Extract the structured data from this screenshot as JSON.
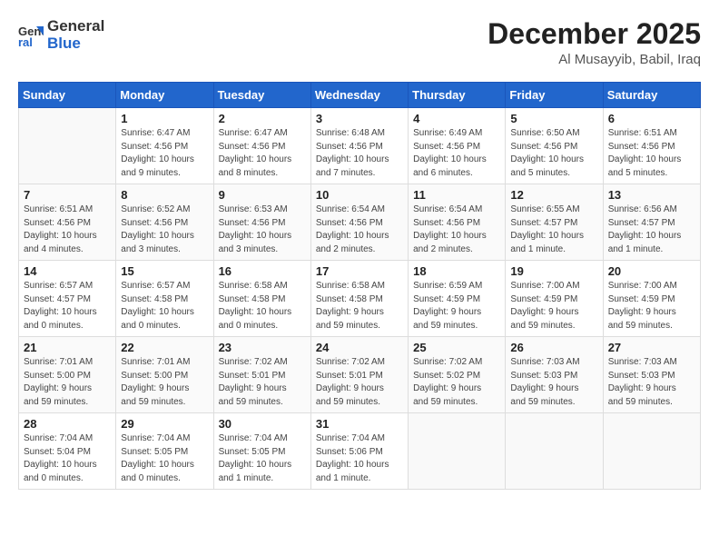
{
  "header": {
    "logo_line1": "General",
    "logo_line2": "Blue",
    "month": "December 2025",
    "location": "Al Musayyib, Babil, Iraq"
  },
  "days_of_week": [
    "Sunday",
    "Monday",
    "Tuesday",
    "Wednesday",
    "Thursday",
    "Friday",
    "Saturday"
  ],
  "weeks": [
    [
      {
        "num": "",
        "info": ""
      },
      {
        "num": "1",
        "info": "Sunrise: 6:47 AM\nSunset: 4:56 PM\nDaylight: 10 hours\nand 9 minutes."
      },
      {
        "num": "2",
        "info": "Sunrise: 6:47 AM\nSunset: 4:56 PM\nDaylight: 10 hours\nand 8 minutes."
      },
      {
        "num": "3",
        "info": "Sunrise: 6:48 AM\nSunset: 4:56 PM\nDaylight: 10 hours\nand 7 minutes."
      },
      {
        "num": "4",
        "info": "Sunrise: 6:49 AM\nSunset: 4:56 PM\nDaylight: 10 hours\nand 6 minutes."
      },
      {
        "num": "5",
        "info": "Sunrise: 6:50 AM\nSunset: 4:56 PM\nDaylight: 10 hours\nand 5 minutes."
      },
      {
        "num": "6",
        "info": "Sunrise: 6:51 AM\nSunset: 4:56 PM\nDaylight: 10 hours\nand 5 minutes."
      }
    ],
    [
      {
        "num": "7",
        "info": "Sunrise: 6:51 AM\nSunset: 4:56 PM\nDaylight: 10 hours\nand 4 minutes."
      },
      {
        "num": "8",
        "info": "Sunrise: 6:52 AM\nSunset: 4:56 PM\nDaylight: 10 hours\nand 3 minutes."
      },
      {
        "num": "9",
        "info": "Sunrise: 6:53 AM\nSunset: 4:56 PM\nDaylight: 10 hours\nand 3 minutes."
      },
      {
        "num": "10",
        "info": "Sunrise: 6:54 AM\nSunset: 4:56 PM\nDaylight: 10 hours\nand 2 minutes."
      },
      {
        "num": "11",
        "info": "Sunrise: 6:54 AM\nSunset: 4:56 PM\nDaylight: 10 hours\nand 2 minutes."
      },
      {
        "num": "12",
        "info": "Sunrise: 6:55 AM\nSunset: 4:57 PM\nDaylight: 10 hours\nand 1 minute."
      },
      {
        "num": "13",
        "info": "Sunrise: 6:56 AM\nSunset: 4:57 PM\nDaylight: 10 hours\nand 1 minute."
      }
    ],
    [
      {
        "num": "14",
        "info": "Sunrise: 6:57 AM\nSunset: 4:57 PM\nDaylight: 10 hours\nand 0 minutes."
      },
      {
        "num": "15",
        "info": "Sunrise: 6:57 AM\nSunset: 4:58 PM\nDaylight: 10 hours\nand 0 minutes."
      },
      {
        "num": "16",
        "info": "Sunrise: 6:58 AM\nSunset: 4:58 PM\nDaylight: 10 hours\nand 0 minutes."
      },
      {
        "num": "17",
        "info": "Sunrise: 6:58 AM\nSunset: 4:58 PM\nDaylight: 9 hours\nand 59 minutes."
      },
      {
        "num": "18",
        "info": "Sunrise: 6:59 AM\nSunset: 4:59 PM\nDaylight: 9 hours\nand 59 minutes."
      },
      {
        "num": "19",
        "info": "Sunrise: 7:00 AM\nSunset: 4:59 PM\nDaylight: 9 hours\nand 59 minutes."
      },
      {
        "num": "20",
        "info": "Sunrise: 7:00 AM\nSunset: 4:59 PM\nDaylight: 9 hours\nand 59 minutes."
      }
    ],
    [
      {
        "num": "21",
        "info": "Sunrise: 7:01 AM\nSunset: 5:00 PM\nDaylight: 9 hours\nand 59 minutes."
      },
      {
        "num": "22",
        "info": "Sunrise: 7:01 AM\nSunset: 5:00 PM\nDaylight: 9 hours\nand 59 minutes."
      },
      {
        "num": "23",
        "info": "Sunrise: 7:02 AM\nSunset: 5:01 PM\nDaylight: 9 hours\nand 59 minutes."
      },
      {
        "num": "24",
        "info": "Sunrise: 7:02 AM\nSunset: 5:01 PM\nDaylight: 9 hours\nand 59 minutes."
      },
      {
        "num": "25",
        "info": "Sunrise: 7:02 AM\nSunset: 5:02 PM\nDaylight: 9 hours\nand 59 minutes."
      },
      {
        "num": "26",
        "info": "Sunrise: 7:03 AM\nSunset: 5:03 PM\nDaylight: 9 hours\nand 59 minutes."
      },
      {
        "num": "27",
        "info": "Sunrise: 7:03 AM\nSunset: 5:03 PM\nDaylight: 9 hours\nand 59 minutes."
      }
    ],
    [
      {
        "num": "28",
        "info": "Sunrise: 7:04 AM\nSunset: 5:04 PM\nDaylight: 10 hours\nand 0 minutes."
      },
      {
        "num": "29",
        "info": "Sunrise: 7:04 AM\nSunset: 5:05 PM\nDaylight: 10 hours\nand 0 minutes."
      },
      {
        "num": "30",
        "info": "Sunrise: 7:04 AM\nSunset: 5:05 PM\nDaylight: 10 hours\nand 1 minute."
      },
      {
        "num": "31",
        "info": "Sunrise: 7:04 AM\nSunset: 5:06 PM\nDaylight: 10 hours\nand 1 minute."
      },
      {
        "num": "",
        "info": ""
      },
      {
        "num": "",
        "info": ""
      },
      {
        "num": "",
        "info": ""
      }
    ]
  ]
}
